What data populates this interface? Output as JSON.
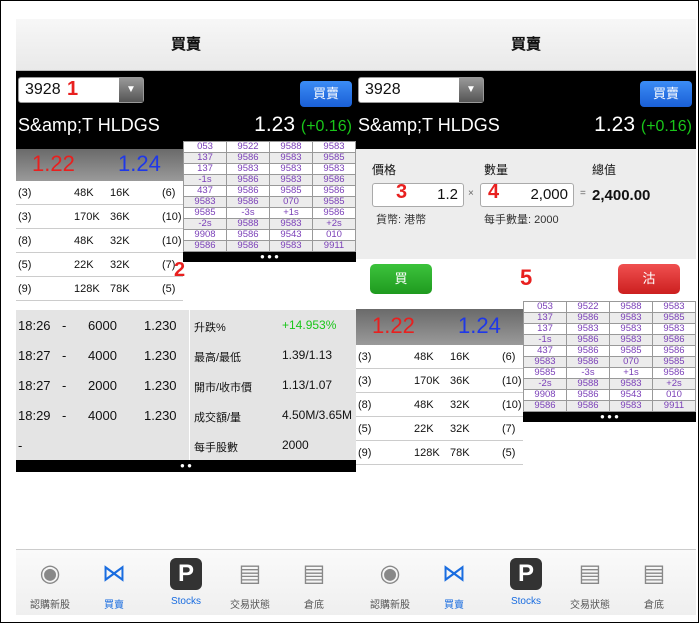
{
  "title": "買賣",
  "left": {
    "code": "3928",
    "marker": "1",
    "buy_label": "買賣",
    "stock_name": "S&amp;T HLDGS",
    "price": "1.23",
    "change": "(+0.16)",
    "bid": "1.22",
    "ask": "1.24",
    "marker2": "2",
    "queue": [
      [
        "(3)",
        "48K",
        "16K",
        "(6)"
      ],
      [
        "(3)",
        "170K",
        "36K",
        "(10)"
      ],
      [
        "(8)",
        "48K",
        "32K",
        "(10)"
      ],
      [
        "(5)",
        "22K",
        "32K",
        "(7)"
      ],
      [
        "(9)",
        "128K",
        "78K",
        "(5)"
      ]
    ],
    "grid": [
      [
        "053",
        "9522",
        "9588",
        "9583"
      ],
      [
        "137",
        "9586",
        "9583",
        "9585"
      ],
      [
        "137",
        "9583",
        "9583",
        "9583"
      ],
      [
        "-1s",
        "9586",
        "9583",
        "9586"
      ],
      [
        "437",
        "9586",
        "9585",
        "9586"
      ],
      [
        "9583",
        "9586",
        "070",
        "9585"
      ],
      [
        "9585",
        "-3s",
        "+1s",
        "9586"
      ],
      [
        "-2s",
        "9588",
        "9583",
        "+2s"
      ],
      [
        "9908",
        "9586",
        "9543",
        "010"
      ],
      [
        "9586",
        "9586",
        "9583",
        "9911"
      ]
    ],
    "trades": [
      [
        "18:26",
        "-",
        "6000",
        "1.230"
      ],
      [
        "18:27",
        "-",
        "4000",
        "1.230"
      ],
      [
        "18:27",
        "-",
        "2000",
        "1.230"
      ],
      [
        "18:29",
        "-",
        "4000",
        "1.230"
      ],
      [
        "-",
        "",
        "",
        ""
      ]
    ],
    "stats": [
      [
        "升跌%",
        "+14.953%"
      ],
      [
        "最高/最低",
        "1.39/1.13"
      ],
      [
        "開市/收市價",
        "1.13/1.07"
      ],
      [
        "成交額/量",
        "4.50M/3.65M"
      ],
      [
        "每手股數",
        "2000"
      ]
    ]
  },
  "right": {
    "code": "3928",
    "buy_label": "買賣",
    "stock_name": "S&amp;T HLDGS",
    "price": "1.23",
    "change": "(+0.16)",
    "price_label": "價格",
    "qty_label": "數量",
    "total_label": "總值",
    "price_value": "1.2",
    "qty_value": "2,000",
    "total_value": "2,400.00",
    "marker3": "3",
    "marker4": "4",
    "marker5": "5",
    "currency": "貨幣: 港幣",
    "lot": "每手數量: 2000",
    "buy_btn": "買",
    "sell_btn": "沽",
    "bid": "1.22",
    "ask": "1.24"
  },
  "tabs": [
    {
      "label": "認購新股",
      "icon": "eye-icon"
    },
    {
      "label": "買賣",
      "icon": "bow-icon"
    },
    {
      "label": "Stocks",
      "icon": "p-logo-icon"
    },
    {
      "label": "交易狀態",
      "icon": "document-icon"
    },
    {
      "label": "倉底",
      "icon": "document-icon"
    }
  ],
  "accent": "#1a6de0",
  "up_color": "#19c619",
  "bid_color": "#e8201f",
  "ask_color": "#1f38e8"
}
